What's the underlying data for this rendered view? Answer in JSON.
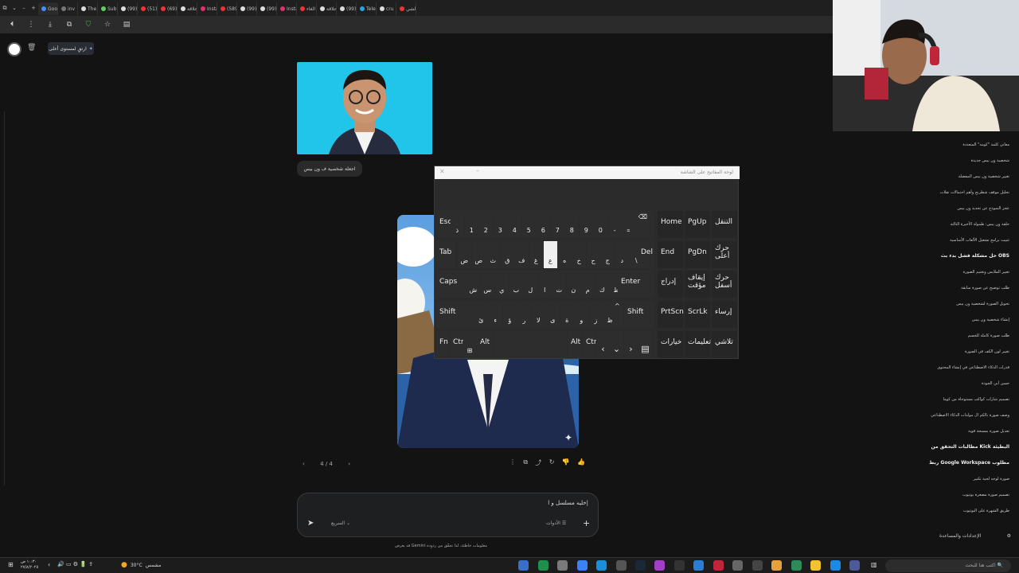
{
  "browser": {
    "tabs": [
      {
        "label": "Goo",
        "color": "#4c8bf5",
        "active": true
      },
      {
        "label": "inv",
        "color": "#777"
      },
      {
        "label": "The",
        "color": "#ddd"
      },
      {
        "label": "Sub",
        "color": "#5cd35c"
      },
      {
        "label": "(99)",
        "color": "#ddd"
      },
      {
        "label": "(51)",
        "color": "#e33"
      },
      {
        "label": "(69)",
        "color": "#e33"
      },
      {
        "label": "علاقة",
        "color": "#ddd"
      },
      {
        "label": "Insta",
        "color": "#e1306c"
      },
      {
        "label": "(589)",
        "color": "#e33"
      },
      {
        "label": "(99)",
        "color": "#ddd"
      },
      {
        "label": "(99)",
        "color": "#ddd"
      },
      {
        "label": "Insta",
        "color": "#e1306c"
      },
      {
        "label": "الغاء",
        "color": "#e33"
      },
      {
        "label": "علاقة",
        "color": "#ddd"
      },
      {
        "label": "(99)",
        "color": "#ddd"
      },
      {
        "label": "Tele",
        "color": "#2aa3e0"
      },
      {
        "label": "cru",
        "color": "#ddd"
      },
      {
        "label": "الشي",
        "color": "#e33"
      }
    ]
  },
  "header": {
    "upgrade_label": "ارتقِ لمستوى أعلى"
  },
  "chat": {
    "user_message": "اجعلة شخصية ف ون بيس",
    "pager": "4 / 4",
    "composer_text": "خليه مسلسل و ا|",
    "model_label": "السريع",
    "tools_label": "الأدوات",
    "disclaimer": "قد يعرض Gemini معلومات خاطئة، لذا تحقّق من ردوده"
  },
  "keyboard": {
    "title": "لوحة المفاتيح على الشاشة",
    "row1": [
      "Esc",
      "ذ",
      "1",
      "2",
      "3",
      "4",
      "5",
      "6",
      "7",
      "8",
      "9",
      "0",
      "-",
      "="
    ],
    "row2": [
      "Tab",
      "ض",
      "ص",
      "ث",
      "ق",
      "ف",
      "غ",
      "ع",
      "ه",
      "خ",
      "ح",
      "ج",
      "د",
      "\\",
      "Del"
    ],
    "row3": [
      "Caps",
      "ش",
      "س",
      "ي",
      "ب",
      "ل",
      "ا",
      "ت",
      "ن",
      "م",
      "ك",
      "ط",
      "Enter"
    ],
    "row4": [
      "Shift",
      "ئ",
      "ء",
      "ؤ",
      "ر",
      "لا",
      "ى",
      "ة",
      "و",
      "ز",
      "ظ",
      "Shift"
    ],
    "row5": [
      "Fn",
      "Ctrl",
      "Alt",
      "Alt",
      "Ctrl"
    ],
    "nav": [
      [
        "Home",
        "PgUp",
        "التنقل"
      ],
      [
        "End",
        "PgDn",
        "حرك أعلى"
      ],
      [
        "إدراج",
        "إيقاف مؤقت",
        "حرك أسفل"
      ],
      [
        "PrtScn",
        "ScrLk",
        "إرساء"
      ],
      [
        "خيارات",
        "تعليمات",
        "تلاشي"
      ]
    ]
  },
  "sidebar": {
    "recents": [
      {
        "label": "معاني كلمة \"كومة\" المتعددة",
        "bold": false
      },
      {
        "label": "شخصية ون بيس جديدة",
        "bold": false
      },
      {
        "label": "تغيير شخصية ون بيس المفضلة",
        "bold": false
      },
      {
        "label": "تحليل موقف شطرنج وأهم احتمالات نقلات",
        "bold": false
      },
      {
        "label": "عجز النموذج عن تحديد ون بيس",
        "bold": false
      },
      {
        "label": "حلقة ون بيس: طمولة الأخيرة الثالثة",
        "bold": false
      },
      {
        "label": "تثبيت برامج تشغيل الألعاب الأساسية",
        "bold": false
      },
      {
        "label": "حل مشكلة فشل بدء بث OBS",
        "bold": true
      },
      {
        "label": "تغيير الملابس وتعتيم الصورة",
        "bold": false
      },
      {
        "label": "طلب توضيح عن صورة سابقة",
        "bold": false
      },
      {
        "label": "تحويل الصورة لشخصية ون بيس",
        "bold": false
      },
      {
        "label": "إنشاء شخصية ون بيس",
        "bold": false
      },
      {
        "label": "طلب صورة كاملة للجسم",
        "bold": false
      },
      {
        "label": "تغيير لون الكف في الصورة",
        "bold": false
      },
      {
        "label": "قدرات الذكاء الاصطناعي في إنشاء المحتوى",
        "bold": false
      },
      {
        "label": "حسن أبي الجودة",
        "bold": false
      },
      {
        "label": "تصميم شارات كواكب مستوحاة من كوما",
        "bold": false
      },
      {
        "label": "وصف صورة بالكم ال مولدات الذكاء الاصطناعي",
        "bold": false
      },
      {
        "label": "تعديل صورة بمسحة قوية",
        "bold": false
      },
      {
        "label": "مطالبات التحقق من Kick البطيئة",
        "bold": true
      },
      {
        "label": "ربط Google Workspace مطلوب",
        "bold": true
      },
      {
        "label": "صورة لوجه لحية تكبير",
        "bold": false
      },
      {
        "label": "تصميم صورة مصغرة يوتيوب",
        "bold": false
      },
      {
        "label": "طريق الشهرة على اليوتيوب",
        "bold": false
      }
    ],
    "settings_label": "الإعدادات والمساعدة"
  },
  "taskbar": {
    "search_placeholder": "اكتب هنا للبحث",
    "weather_temp": "30°C",
    "weather_desc": "مشمس",
    "time": "١٠:٣٠ ص",
    "date": "٢٧/٨/٢٠٢٥"
  }
}
